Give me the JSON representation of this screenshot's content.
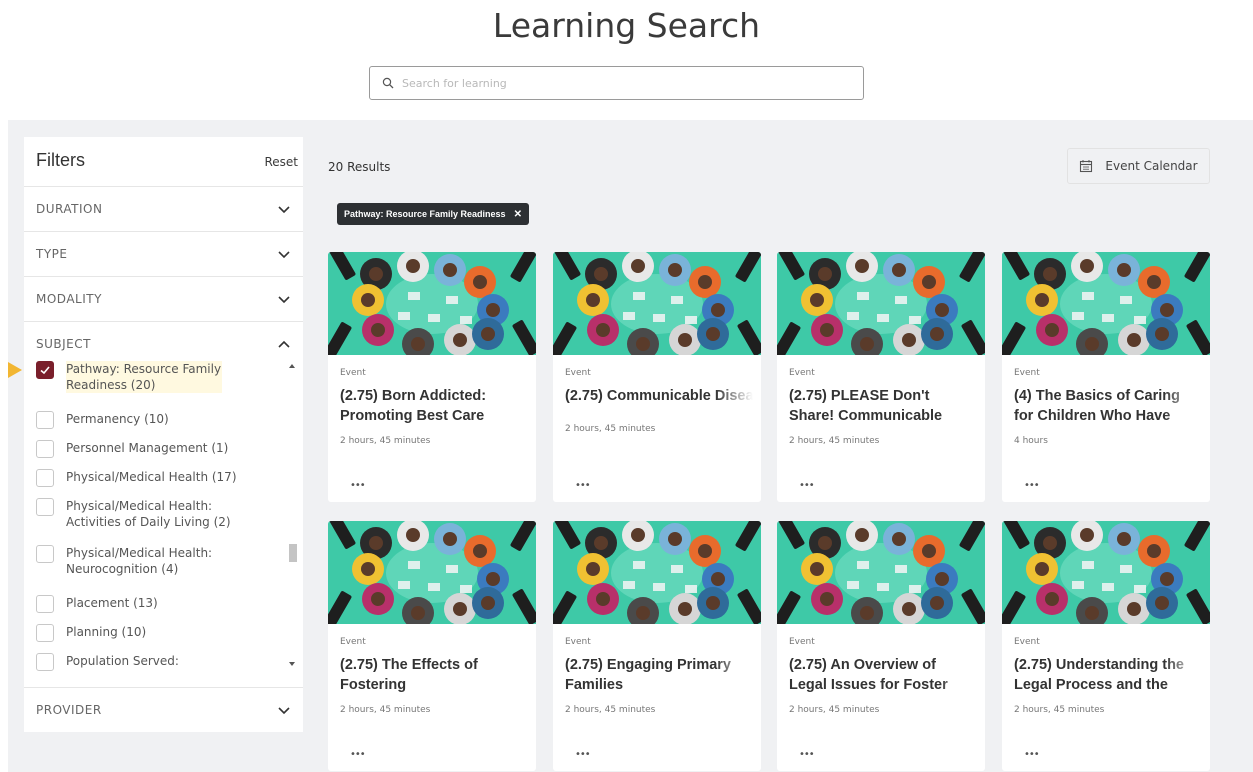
{
  "page": {
    "title": "Learning Search"
  },
  "search": {
    "placeholder": "Search for learning",
    "value": ""
  },
  "filters": {
    "title": "Filters",
    "reset_label": "Reset",
    "sections": [
      {
        "label": "DURATION",
        "expanded": false
      },
      {
        "label": "TYPE",
        "expanded": false
      },
      {
        "label": "MODALITY",
        "expanded": false
      },
      {
        "label": "SUBJECT",
        "expanded": true
      },
      {
        "label": "PROVIDER",
        "expanded": false
      }
    ],
    "subject_options": [
      {
        "label": "Pathway: Resource Family Readiness (20)",
        "checked": true
      },
      {
        "label": "Permanency (10)",
        "checked": false
      },
      {
        "label": "Personnel Management (1)",
        "checked": false
      },
      {
        "label": "Physical/Medical Health (17)",
        "checked": false
      },
      {
        "label": "Physical/Medical Health: Activities of Daily Living (2)",
        "checked": false
      },
      {
        "label": "Physical/Medical Health: Neurocognition (4)",
        "checked": false
      },
      {
        "label": "Placement (13)",
        "checked": false
      },
      {
        "label": "Planning (10)",
        "checked": false
      },
      {
        "label": "Population Served:",
        "checked": false
      }
    ]
  },
  "results": {
    "count_label": "20 Results",
    "event_calendar_label": "Event Calendar",
    "active_chip": "Pathway: Resource Family Readiness",
    "cards": [
      {
        "type": "Event",
        "title_lines": [
          "(2.75) Born Addicted:",
          "Promoting Best Care"
        ],
        "duration": "2 hours, 45 minutes",
        "more": "•••"
      },
      {
        "type": "Event",
        "title_lines": [
          "(2.75) Communicable Disea"
        ],
        "duration": "2 hours, 45 minutes",
        "more": "•••"
      },
      {
        "type": "Event",
        "title_lines": [
          "(2.75) PLEASE Don't",
          "Share! Communicable"
        ],
        "duration": "2 hours, 45 minutes",
        "more": "•••"
      },
      {
        "type": "Event",
        "title_lines": [
          "(4) The Basics of Caring",
          "for Children Who Have"
        ],
        "duration": "4 hours",
        "more": "•••"
      },
      {
        "type": "Event",
        "title_lines": [
          "(2.75) The Effects of",
          "Fostering"
        ],
        "duration": "2 hours, 45 minutes",
        "more": "•••"
      },
      {
        "type": "Event",
        "title_lines": [
          "(2.75) Engaging Primary",
          "Families"
        ],
        "duration": "2 hours, 45 minutes",
        "more": "•••"
      },
      {
        "type": "Event",
        "title_lines": [
          "(2.75) An Overview of",
          "Legal Issues for Foster"
        ],
        "duration": "2 hours, 45 minutes",
        "more": "•••"
      },
      {
        "type": "Event",
        "title_lines": [
          "(2.75) Understanding the",
          "Legal Process and the"
        ],
        "duration": "2 hours, 45 minutes",
        "more": "•••"
      }
    ]
  },
  "colors": {
    "accent": "#7a1f2b",
    "chip_bg": "#2d3033",
    "pointer": "#f2b632",
    "card_image_bg": "#3ec9a7"
  },
  "icons": {
    "search": "search-icon",
    "calendar": "calendar-icon",
    "chevron": "chevron-down-icon",
    "check": "check-icon"
  }
}
